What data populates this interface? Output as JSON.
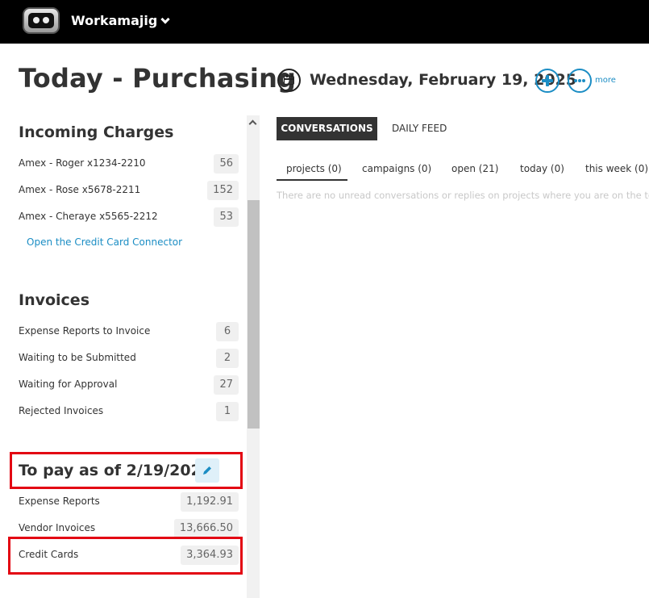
{
  "header": {
    "app_name": "Workamajig"
  },
  "page_title": "Today - Purchasing",
  "date_header": {
    "date": "Wednesday, February 19, 2025",
    "more_label": "more"
  },
  "incoming_charges": {
    "title": "Incoming Charges",
    "items": [
      {
        "label": "Amex - Roger x1234-2210",
        "count": "56"
      },
      {
        "label": "Amex - Rose x5678-2211",
        "count": "152"
      },
      {
        "label": "Amex - Cheraye x5565-2212",
        "count": "53"
      }
    ],
    "link": "Open the Credit Card Connector"
  },
  "invoices": {
    "title": "Invoices",
    "items": [
      {
        "label": "Expense Reports to Invoice",
        "count": "6"
      },
      {
        "label": "Waiting to be Submitted",
        "count": "2"
      },
      {
        "label": "Waiting for Approval",
        "count": "27"
      },
      {
        "label": "Rejected Invoices",
        "count": "1"
      }
    ]
  },
  "to_pay": {
    "title": "To pay as of 2/19/2025",
    "items": [
      {
        "label": "Expense Reports",
        "amount": "1,192.91"
      },
      {
        "label": "Vendor Invoices",
        "amount": "13,666.50"
      },
      {
        "label": "Credit Cards",
        "amount": "3,364.93"
      }
    ]
  },
  "tabs": {
    "conversations": "CONVERSATIONS",
    "daily_feed": "DAILY FEED"
  },
  "subtabs": [
    "projects (0)",
    "campaigns (0)",
    "open (21)",
    "today (0)",
    "this week (0)"
  ],
  "empty_message": "There are no unread conversations or replies on projects where you are on the team",
  "colors": {
    "accent": "#1b8dc4",
    "highlight": "#e30613",
    "topbar": "#000000"
  }
}
